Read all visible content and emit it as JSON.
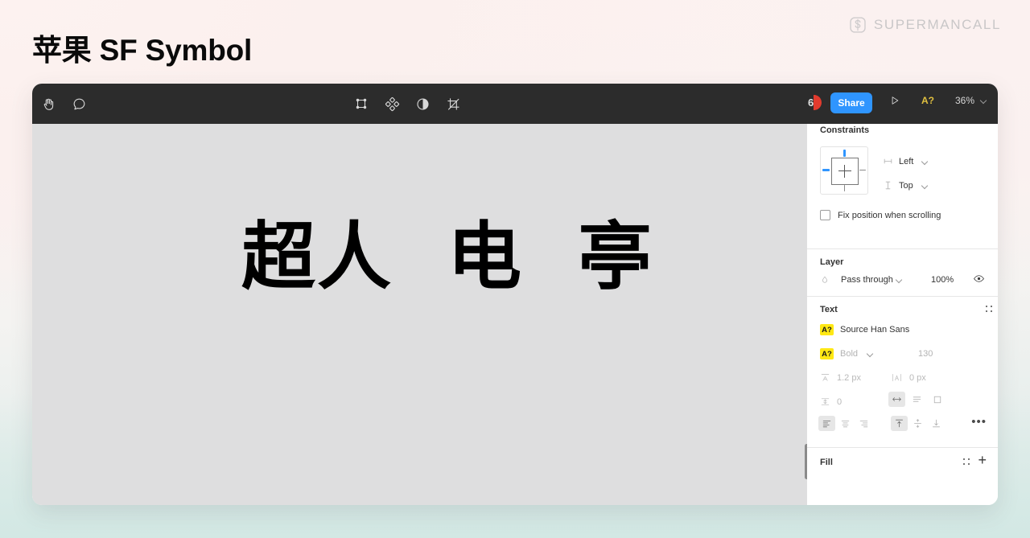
{
  "header": {
    "title": "苹果 SF Symbol",
    "brand_name": "SUPERMANCALL",
    "brand_logo_icon": "s-monogram-icon"
  },
  "toolbar": {
    "hand_tool_icon": "hand-icon",
    "comment_tool_icon": "comment-bubble-icon",
    "frame_tool_icon": "frame-select-icon",
    "component_tool_icon": "component-diamond-icon",
    "contrast_tool_icon": "contrast-half-circle-icon",
    "crop_tool_icon": "crop-slice-icon",
    "avatar_initial": "6",
    "share_label": "Share",
    "present_icon": "play-triangle-icon",
    "font_warning_label": "A?",
    "zoom_level": "36%",
    "zoom_chevron_icon": "chevron-down-icon"
  },
  "canvas": {
    "text": "超人  电  亭",
    "background_color": "#dededf",
    "scrollbar_icon": "vertical-scrollbar-thumb"
  },
  "panel": {
    "constraints": {
      "title": "Constraints",
      "horizontal_icon": "horizontal-constraint-icon",
      "horizontal_value": "Left",
      "vertical_icon": "vertical-constraint-icon",
      "vertical_value": "Top",
      "fix_position_label": "Fix position when scrolling",
      "fix_position_checked": false
    },
    "layer": {
      "title": "Layer",
      "blend_mode_icon": "blend-mode-droplet-icon",
      "blend_mode": "Pass through",
      "opacity": "100%",
      "visibility_icon": "eye-icon"
    },
    "text": {
      "title": "Text",
      "settings_icon": "text-settings-grid-icon",
      "font_warning_badge": "A?",
      "font_family": "Source Han Sans",
      "font_style": "Bold",
      "font_size": "130",
      "line_height_icon": "line-height-icon",
      "line_height": "1.2 px",
      "letter_spacing_icon": "letter-spacing-icon",
      "letter_spacing": "0 px",
      "paragraph_spacing_icon": "paragraph-spacing-icon",
      "paragraph_spacing": "0",
      "resize_auto_width_icon": "auto-width-icon",
      "resize_auto_height_icon": "auto-height-icon",
      "resize_fixed_icon": "fixed-size-icon",
      "align_left_icon": "align-left-icon",
      "align_center_icon": "align-center-icon",
      "align_right_icon": "align-right-icon",
      "valign_top_icon": "align-top-icon",
      "valign_middle_icon": "align-middle-icon",
      "valign_bottom_icon": "align-bottom-icon",
      "more_options": "•••"
    },
    "fill": {
      "title": "Fill",
      "settings_icon": "fill-settings-grid-icon",
      "add_label": "+"
    }
  },
  "colors": {
    "accent_blue": "#2f95ff",
    "warning_yellow": "#ffe814",
    "toolbar_dark": "#2c2c2c",
    "canvas_gray": "#dededf"
  }
}
